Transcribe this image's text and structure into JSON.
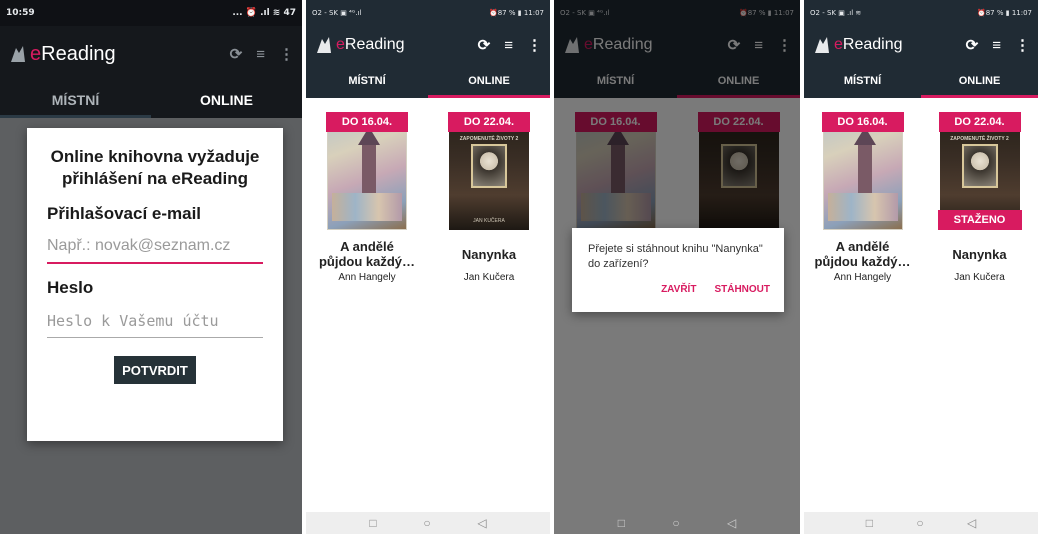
{
  "app": {
    "logo_e": "e",
    "logo_rest": "Reading"
  },
  "tabs": {
    "local": "MÍSTNÍ",
    "online": "ONLINE"
  },
  "screen1": {
    "status_time": "10:59",
    "status_right": "... ⏰ .ıl ≋ 47",
    "login": {
      "title": "Online knihovna vyžaduje přihlášení na eReading",
      "email_label": "Přihlašovací e-mail",
      "email_placeholder": "Např.: novak@seznam.cz",
      "password_label": "Heslo",
      "password_placeholder": "Heslo k Vašemu účtu",
      "confirm": "POTVRDIT"
    }
  },
  "status_small": {
    "left": "O2 - SK ▣ ⁴ᴳ.ıl",
    "right": "⏰87 % ▮ 11:07"
  },
  "status_small_s4": {
    "left": "O2 - SK ▣ .ıl ≋",
    "right": "⏰87 % ▮ 11:07"
  },
  "books": [
    {
      "title": "A andělé půjdou každý…",
      "author": "Ann Hangely",
      "due": "DO 16.04."
    },
    {
      "title": "Nanynka",
      "author": "Jan Kučera",
      "due": "DO 22.04.",
      "cover_series": "ZAPOMENUTÉ ŽIVOTY 2",
      "cover_author": "JAN KUČERA"
    }
  ],
  "download_dialog": {
    "text": "Přejete si stáhnout knihu \"Nanynka\" do zařízení?",
    "close": "ZAVŘÍT",
    "download": "STÁHNOUT"
  },
  "downloaded_badge": "STAŽENO",
  "nav": {
    "recent": "□",
    "home": "○",
    "back": "◁"
  }
}
